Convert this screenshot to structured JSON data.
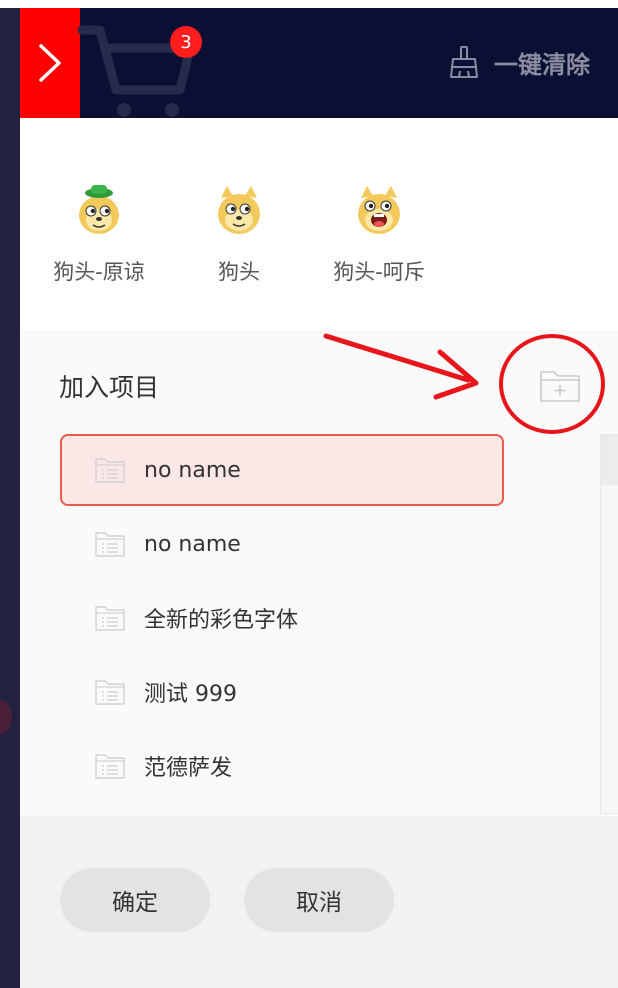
{
  "header": {
    "cart_badge_count": "3",
    "clear_all_label": "一键清除",
    "accent_color": "#ff0000",
    "background_color": "#0b0f33"
  },
  "emojis": [
    {
      "label": "狗头-原谅",
      "icon": "doge-green-hat-icon"
    },
    {
      "label": "狗头",
      "icon": "doge-icon"
    },
    {
      "label": "狗头-呵斥",
      "icon": "doge-shouting-icon"
    }
  ],
  "project_panel": {
    "title": "加入项目",
    "add_icon": "add-folder-icon",
    "items": [
      {
        "label": "no name",
        "selected": true
      },
      {
        "label": "no name",
        "selected": false
      },
      {
        "label": "全新的彩色字体",
        "selected": false
      },
      {
        "label": "测试 999",
        "selected": false
      },
      {
        "label": "范德萨发",
        "selected": false
      }
    ]
  },
  "footer": {
    "confirm_label": "确定",
    "cancel_label": "取消"
  },
  "annotation_color": "#e8151b"
}
